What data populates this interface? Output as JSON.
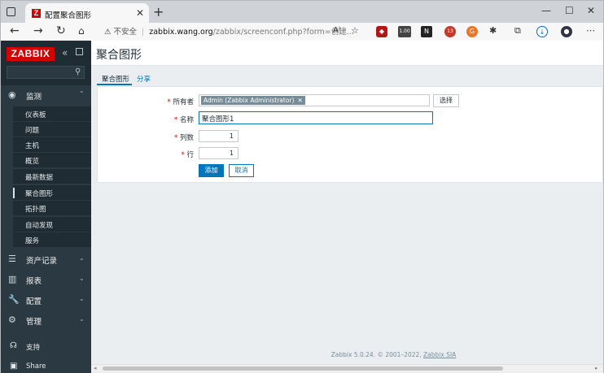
{
  "browser": {
    "tab_title": "配置聚合图形",
    "tab_favicon": "Z",
    "url_insecure_label": "不安全",
    "url_host": "zabbix.wang.org",
    "url_path": "/zabbix/screenconf.php?form=创建...",
    "ext_badge_1": "1.00",
    "ext_badge_2": "13"
  },
  "sidebar": {
    "logo": "ZABBIX",
    "monitoring": {
      "label": "监测",
      "items": [
        "仪表板",
        "问题",
        "主机",
        "概览",
        "最新数据",
        "聚合图形",
        "拓扑图",
        "自动发现",
        "服务"
      ],
      "active_index": 5
    },
    "menus": [
      {
        "label": "资产记录",
        "icon": "list-icon"
      },
      {
        "label": "报表",
        "icon": "report-chart-icon"
      },
      {
        "label": "配置",
        "icon": "wrench-icon"
      },
      {
        "label": "管理",
        "icon": "gear-icon"
      }
    ],
    "footer": [
      {
        "label": "支持",
        "icon": "headset-icon"
      },
      {
        "label": "Share",
        "icon": "share-icon"
      }
    ]
  },
  "main": {
    "title": "聚合图形",
    "tabs": [
      "聚合图形",
      "分享"
    ],
    "form": {
      "owner_label": "所有者",
      "owner_value": "Admin (Zabbix Administrator)",
      "select_button": "选择",
      "name_label": "名称",
      "name_value": "聚合图形1",
      "columns_label": "列数",
      "columns_value": "1",
      "rows_label": "行",
      "rows_value": "1",
      "add_button": "添加",
      "cancel_button": "取消"
    },
    "footer": {
      "text": "Zabbix 5.0.24. © 2001–2022, ",
      "link": "Zabbix SIA"
    }
  }
}
